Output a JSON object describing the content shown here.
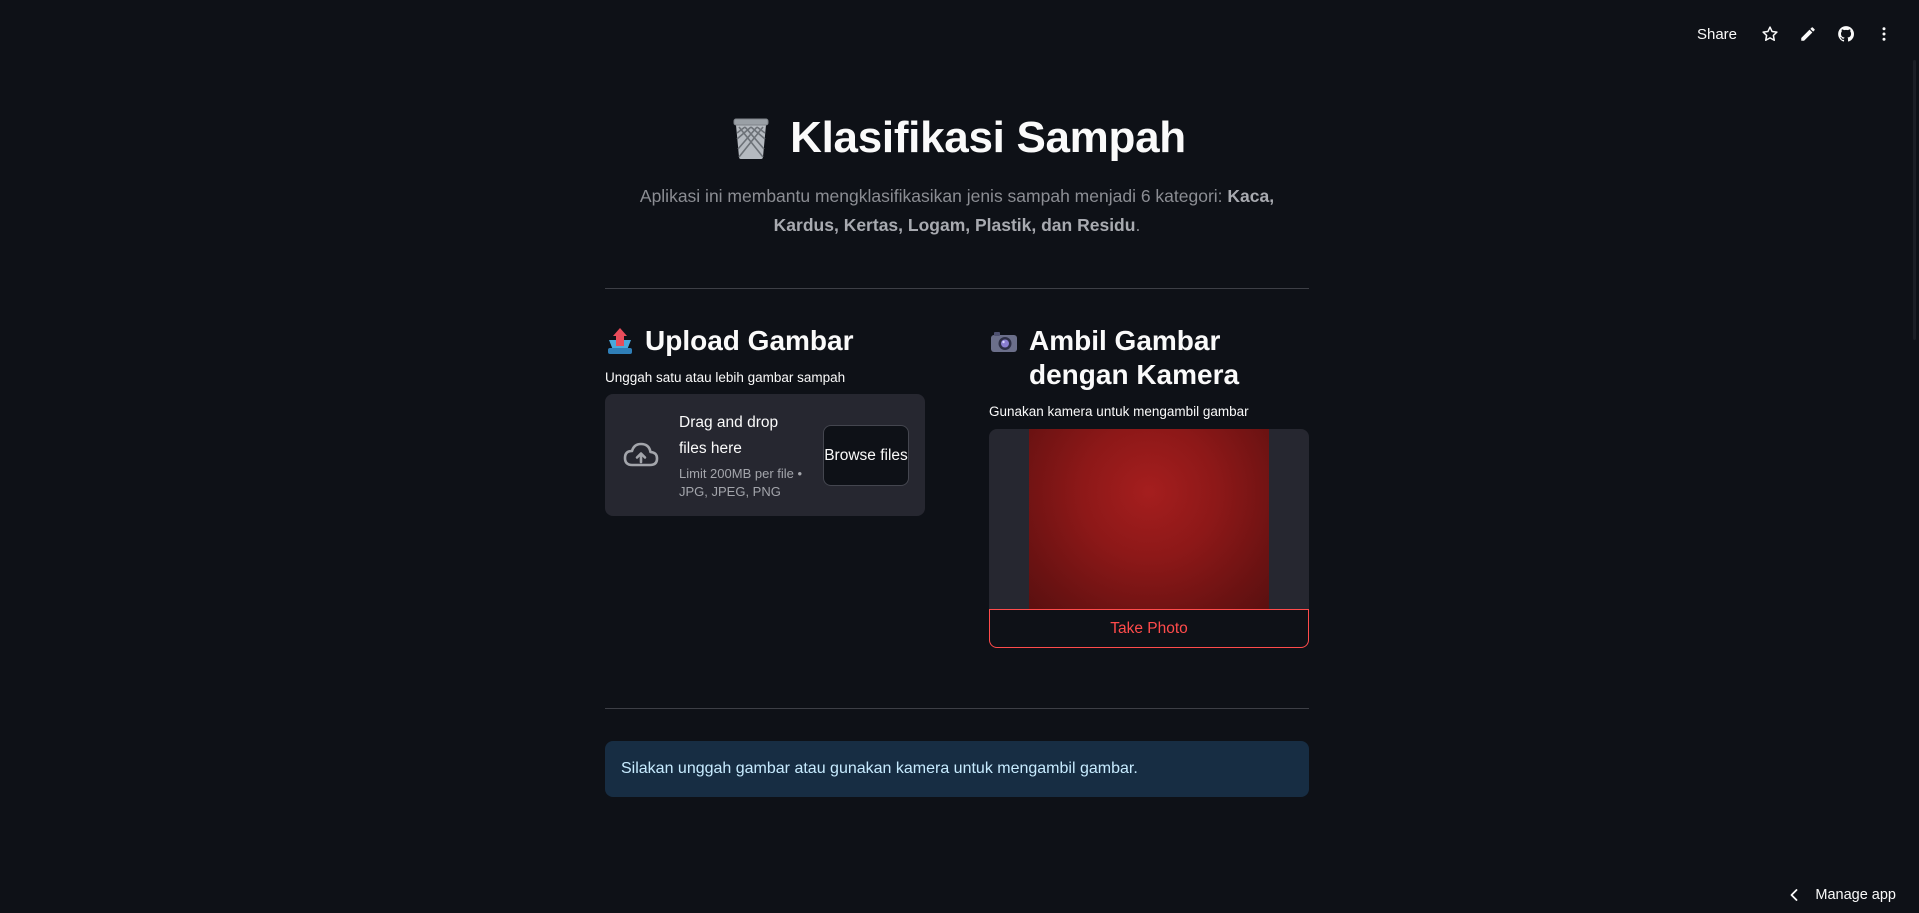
{
  "toolbar": {
    "share_label": "Share",
    "icons": [
      "star-icon",
      "pencil-icon",
      "github-icon",
      "more-vertical-icon"
    ]
  },
  "header": {
    "icon": "wastebasket-icon",
    "title": "Klasifikasi Sampah",
    "subtitle_prefix": "Aplikasi ini membantu mengklasifikasikan jenis sampah menjadi 6 kategori: ",
    "subtitle_bold": "Kaca, Kardus, Kertas, Logam, Plastik, dan Residu",
    "subtitle_suffix": "."
  },
  "upload": {
    "icon": "inbox-tray-icon",
    "heading": "Upload Gambar",
    "label": "Unggah satu atau lebih gambar sampah",
    "drop_text": "Drag and drop files here",
    "limit_text": "Limit 200MB per file • JPG, JPEG, PNG",
    "browse_label": "Browse files"
  },
  "camera": {
    "icon": "camera-icon",
    "heading": "Ambil Gambar dengan Kamera",
    "label": "Gunakan kamera untuk mengambil gambar",
    "button_label": "Take Photo"
  },
  "info": {
    "message": "Silakan unggah gambar atau gunakan kamera untuk mengambil gambar."
  },
  "footer": {
    "manage_label": "Manage app"
  },
  "colors": {
    "background": "#0e1117",
    "accent": "#ff4b4b",
    "info_bg": "#172d43",
    "info_text": "#c7ebff"
  }
}
